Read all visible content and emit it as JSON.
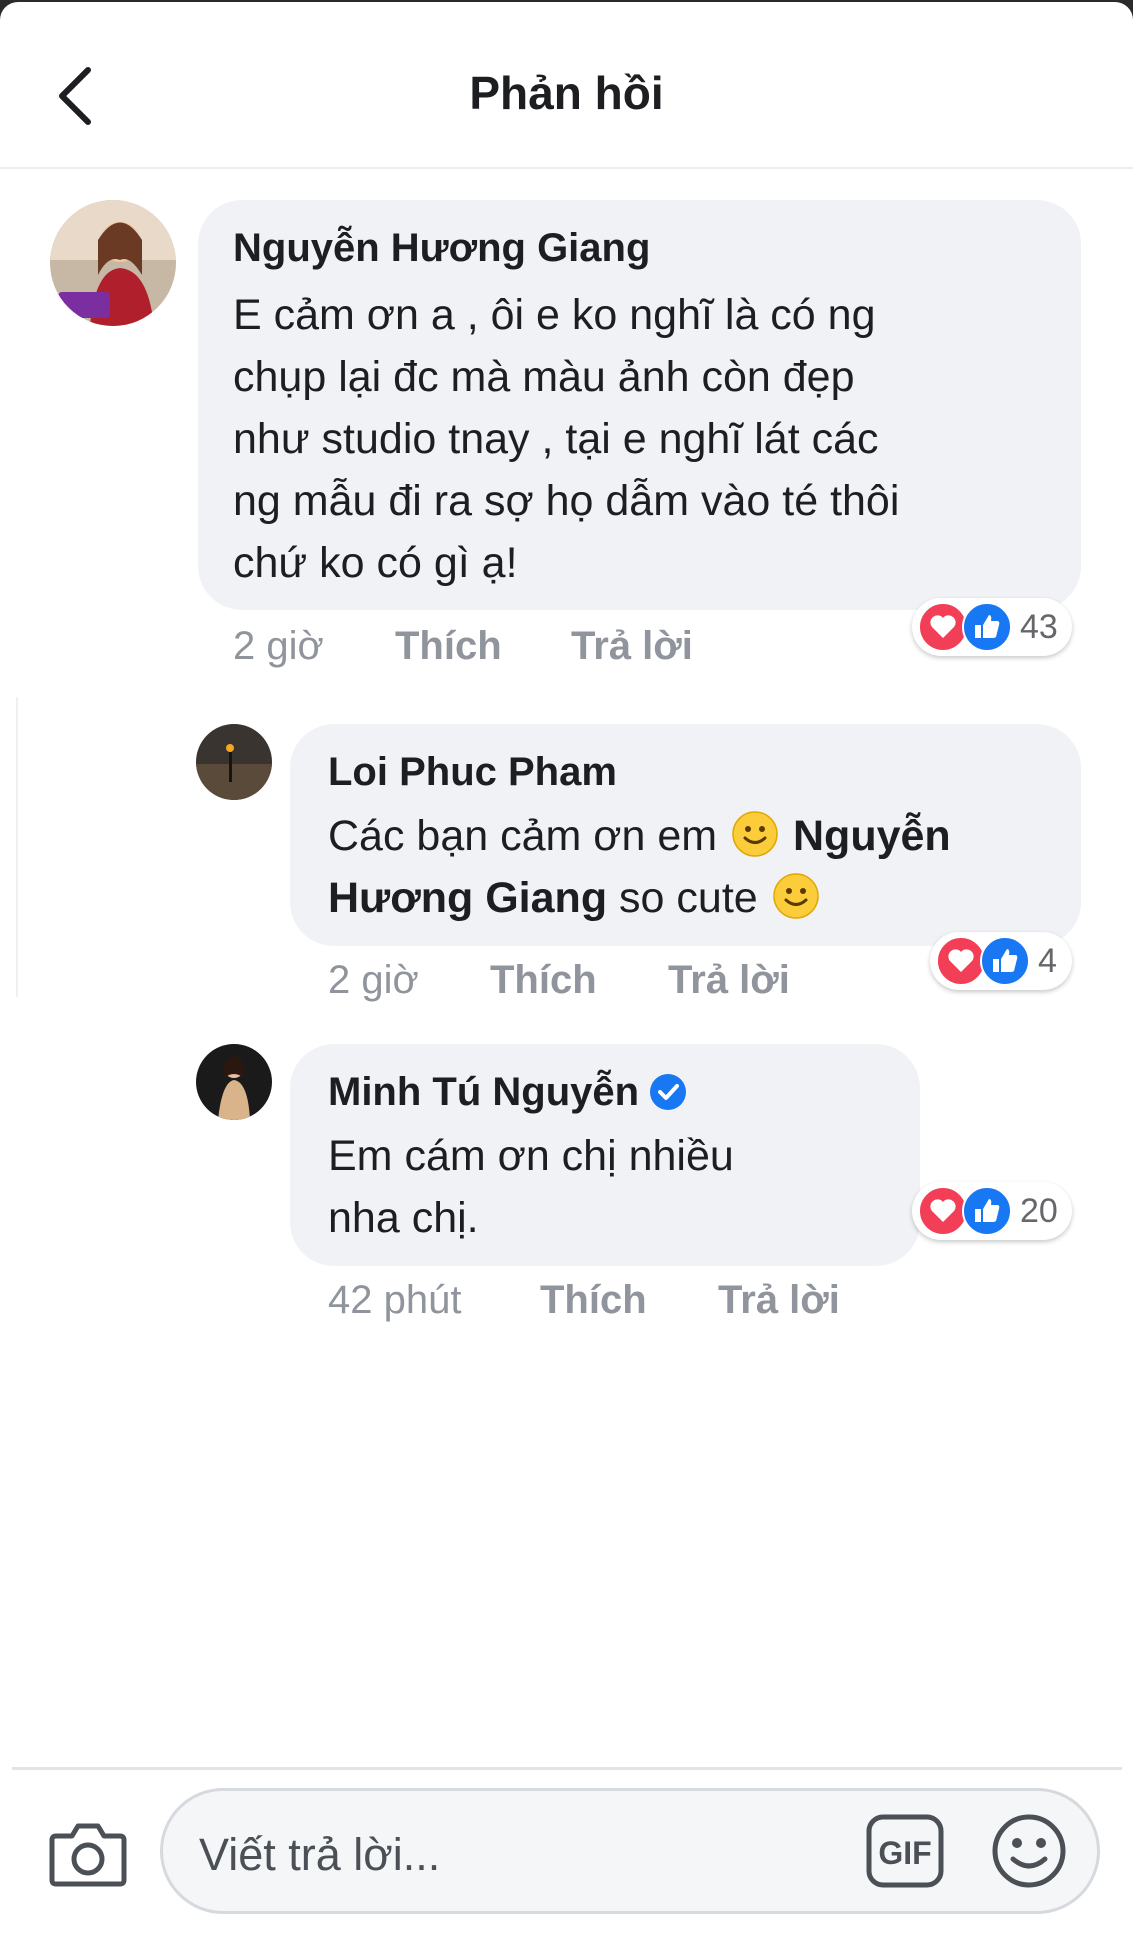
{
  "header": {
    "title": "Phản hồi",
    "back_icon": "chevron-left-icon"
  },
  "comments": [
    {
      "author": "Nguyễn Hương Giang",
      "text_lines": [
        "E cảm ơn a , ôi e ko nghĩ là có ng",
        "chụp lại đc mà màu ảnh còn đẹp",
        "như studio tnay , tại e nghĩ lát các",
        "ng mẫu đi ra sợ họ dẫm vào té thôi",
        "chứ ko có gì ạ!"
      ],
      "time": "2 giờ",
      "like_label": "Thích",
      "reply_label": "Trả lời",
      "reaction_count": "43",
      "reaction_icons": [
        "love-icon",
        "like-icon"
      ]
    },
    {
      "author": "Loi Phuc Pham",
      "text_part1": "Các bạn cảm ơn em",
      "mention_part1": "Nguyễn",
      "mention_part2": "Hương Giang",
      "text_part2": "so cute",
      "time": "2 giờ",
      "like_label": "Thích",
      "reply_label": "Trả lời",
      "reaction_count": "4",
      "reaction_icons": [
        "love-icon",
        "like-icon"
      ]
    },
    {
      "author": "Minh Tú Nguyễn",
      "verified": true,
      "text_lines": [
        "Em cám ơn chị nhiều",
        "nha chị."
      ],
      "time": "42 phút",
      "like_label": "Thích",
      "reply_label": "Trả lời",
      "reaction_count": "20",
      "reaction_icons": [
        "love-icon",
        "like-icon"
      ]
    }
  ],
  "composer": {
    "placeholder": "Viết trả lời...",
    "gif_label": "GIF",
    "icons": [
      "camera-icon",
      "gif-icon",
      "emoji-icon"
    ]
  },
  "colors": {
    "bubble_bg": "#f0f2f5",
    "like_blue": "#1877f2",
    "love_red": "#f33e58",
    "meta_gray": "#90949c"
  }
}
